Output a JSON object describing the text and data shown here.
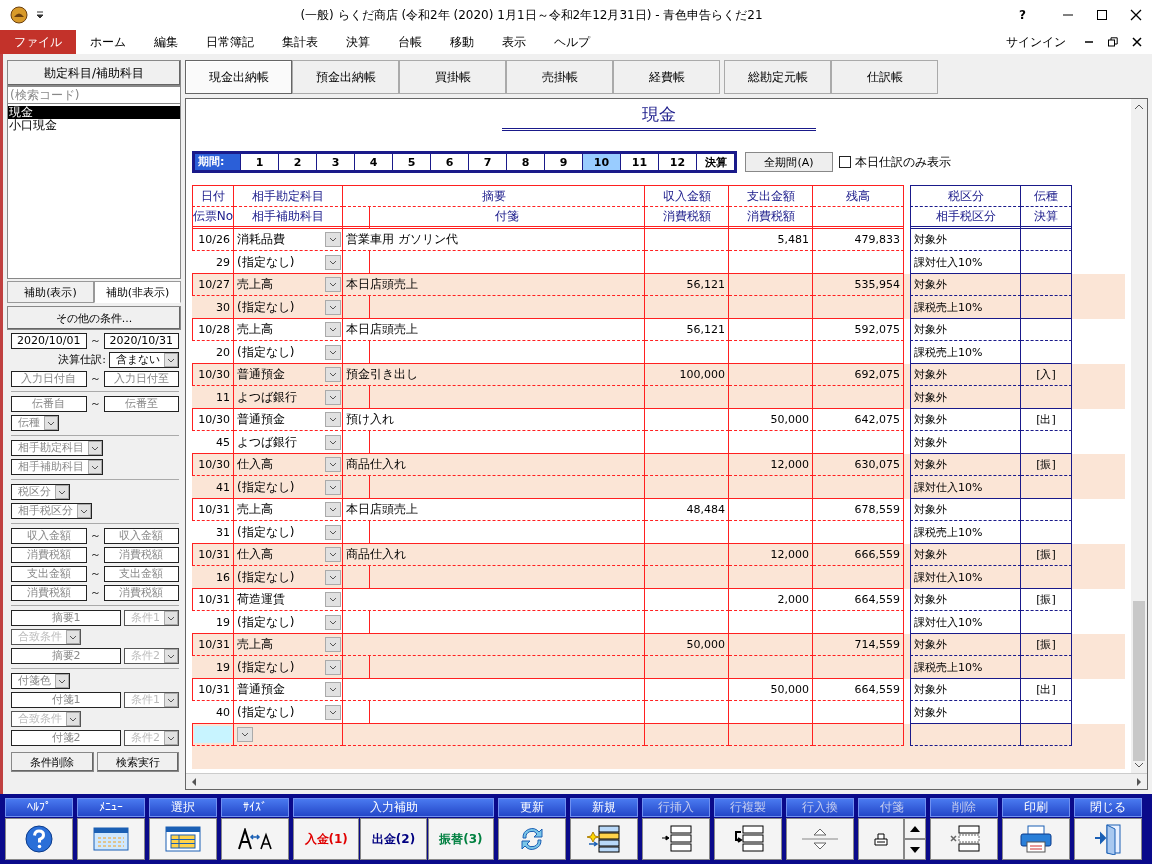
{
  "window": {
    "title": "(一般) らくだ商店 (令和2年 (2020) 1月1日～令和2年12月31日) - 青色申告らくだ21",
    "help": "?"
  },
  "menu": {
    "items": [
      {
        "label": "ファイル",
        "selected": true
      },
      {
        "label": "ホーム",
        "selected": false
      },
      {
        "label": "編集",
        "selected": false
      },
      {
        "label": "日常簿記",
        "selected": false
      },
      {
        "label": "集計表",
        "selected": false
      },
      {
        "label": "決算",
        "selected": false
      },
      {
        "label": "台帳",
        "selected": false
      },
      {
        "label": "移動",
        "selected": false
      },
      {
        "label": "表示",
        "selected": false
      },
      {
        "label": "ヘルプ",
        "selected": false
      }
    ],
    "sign_in": "サインイン"
  },
  "account_panel": {
    "title": "勘定科目/補助科目",
    "search": {
      "placeholder": "(検索コード)"
    },
    "accounts": [
      {
        "label": "現金",
        "selected": true
      },
      {
        "label": "小口現金",
        "selected": false
      }
    ],
    "sub_tabs": [
      {
        "label": "補助(表示)",
        "selected": false
      },
      {
        "label": "補助(非表示)",
        "selected": true
      }
    ],
    "more_button": "その他の条件..."
  },
  "filter_groups": [
    [
      [
        {
          "kind": "input",
          "value": "2020/10/01"
        },
        {
          "kind": "tilde",
          "text": "～"
        },
        {
          "kind": "input",
          "value": "2020/10/31"
        }
      ],
      [
        {
          "kind": "label",
          "text": "決算仕訳:"
        },
        {
          "kind": "select",
          "value": "含まない",
          "disabled": false
        }
      ],
      [
        {
          "kind": "input",
          "placeholder": "入力日付自"
        },
        {
          "kind": "tilde",
          "text": "～"
        },
        {
          "kind": "input",
          "placeholder": "入力日付至"
        }
      ]
    ],
    [
      [
        {
          "kind": "input",
          "placeholder": "伝番自"
        },
        {
          "kind": "tilde",
          "text": "～"
        },
        {
          "kind": "input",
          "placeholder": "伝番至"
        }
      ],
      [
        {
          "kind": "select",
          "placeholder": "伝種",
          "disabled": false
        }
      ]
    ],
    [
      [
        {
          "kind": "select",
          "placeholder": "相手勘定科目",
          "disabled": false
        }
      ],
      [
        {
          "kind": "select",
          "placeholder": "相手補助科目",
          "disabled": false
        }
      ]
    ],
    [
      [
        {
          "kind": "select",
          "placeholder": "税区分",
          "disabled": false
        }
      ],
      [
        {
          "kind": "select",
          "placeholder": "相手税区分",
          "disabled": false
        }
      ]
    ],
    [
      [
        {
          "kind": "input",
          "placeholder": "収入金額"
        },
        {
          "kind": "tilde",
          "text": "～"
        },
        {
          "kind": "input",
          "placeholder": "収入金額"
        }
      ],
      [
        {
          "kind": "input",
          "placeholder": "消費税額"
        },
        {
          "kind": "tilde",
          "text": "～"
        },
        {
          "kind": "input",
          "placeholder": "消費税額"
        }
      ],
      [
        {
          "kind": "input",
          "placeholder": "支出金額"
        },
        {
          "kind": "tilde",
          "text": "～"
        },
        {
          "kind": "input",
          "placeholder": "支出金額"
        }
      ],
      [
        {
          "kind": "input",
          "placeholder": "消費税額"
        },
        {
          "kind": "tilde",
          "text": "～"
        },
        {
          "kind": "input",
          "placeholder": "消費税額"
        }
      ]
    ],
    [
      [
        {
          "kind": "input",
          "placeholder": "摘要1"
        },
        {
          "kind": "select",
          "placeholder": "条件1",
          "disabled": true
        }
      ],
      [
        {
          "kind": "select",
          "placeholder": "合致条件",
          "disabled": true
        }
      ],
      [
        {
          "kind": "input",
          "placeholder": "摘要2"
        },
        {
          "kind": "select",
          "placeholder": "条件2",
          "disabled": true
        }
      ]
    ],
    [
      [
        {
          "kind": "select",
          "placeholder": "付箋色",
          "disabled": false
        }
      ],
      [
        {
          "kind": "input",
          "placeholder": "付箋1"
        },
        {
          "kind": "select",
          "placeholder": "条件1",
          "disabled": true
        }
      ],
      [
        {
          "kind": "select",
          "placeholder": "合致条件",
          "disabled": true
        }
      ],
      [
        {
          "kind": "input",
          "placeholder": "付箋2"
        },
        {
          "kind": "select",
          "placeholder": "条件2",
          "disabled": true
        }
      ]
    ]
  ],
  "filter_buttons": [
    "条件削除",
    "検索実行"
  ],
  "tab_groups": [
    [
      {
        "label": "現金出納帳",
        "selected": true
      },
      {
        "label": "預金出納帳",
        "selected": false
      },
      {
        "label": "買掛帳",
        "selected": false
      },
      {
        "label": "売掛帳",
        "selected": false
      },
      {
        "label": "経費帳",
        "selected": false
      }
    ],
    [
      {
        "label": "総勘定元帳",
        "selected": false
      },
      {
        "label": "仕訳帳",
        "selected": false
      }
    ]
  ],
  "ledger_title": "現金",
  "period": {
    "label": "期間:",
    "items": [
      {
        "label": "1",
        "selected": false
      },
      {
        "label": "2",
        "selected": false
      },
      {
        "label": "3",
        "selected": false
      },
      {
        "label": "4",
        "selected": false
      },
      {
        "label": "5",
        "selected": false
      },
      {
        "label": "6",
        "selected": false
      },
      {
        "label": "7",
        "selected": false
      },
      {
        "label": "8",
        "selected": false
      },
      {
        "label": "9",
        "selected": false
      },
      {
        "label": "10",
        "selected": true
      },
      {
        "label": "11",
        "selected": false
      },
      {
        "label": "12",
        "selected": false
      },
      {
        "label": "決算",
        "selected": false
      }
    ],
    "all_button": "全期間(A)",
    "today_only": {
      "label": "本日仕訳のみ表示",
      "checked": false
    }
  },
  "table": {
    "columns_top": [
      "日付",
      "相手勘定科目",
      "摘要",
      "収入金額",
      "支出金額",
      "残高",
      "税区分",
      "伝種"
    ],
    "columns_bottom": [
      "伝票No",
      "相手補助科目",
      "付箋",
      "消費税額",
      "消費税額",
      "相手税区分",
      "決算"
    ],
    "rows": [
      {
        "date": "10/26",
        "account": "消耗品費",
        "memo": "営業車用 ガソリン代",
        "expense": "5,481",
        "balance": "479,833",
        "tax_class": "対象外",
        "slip_no": "29",
        "sub_account": "(指定なし)",
        "partner_tax": "課対仕入10%"
      },
      {
        "date": "10/27",
        "account": "売上高",
        "memo": "本日店頭売上",
        "income": "56,121",
        "balance": "535,954",
        "tax_class": "対象外",
        "slip_no": "30",
        "sub_account": "(指定なし)",
        "partner_tax": "課税売上10%"
      },
      {
        "date": "10/28",
        "account": "売上高",
        "memo": "本日店頭売上",
        "income": "56,121",
        "balance": "592,075",
        "tax_class": "対象外",
        "slip_no": "20",
        "sub_account": "(指定なし)",
        "partner_tax": "課税売上10%"
      },
      {
        "date": "10/30",
        "account": "普通預金",
        "memo": "預金引き出し",
        "income": "100,000",
        "balance": "692,075",
        "tax_class": "対象外",
        "slip_type": "[入]",
        "slip_no": "11",
        "sub_account": "よつば銀行",
        "partner_tax": "対象外"
      },
      {
        "date": "10/30",
        "account": "普通預金",
        "memo": "預け入れ",
        "expense": "50,000",
        "balance": "642,075",
        "tax_class": "対象外",
        "slip_type": "[出]",
        "slip_no": "45",
        "sub_account": "よつば銀行",
        "partner_tax": "対象外"
      },
      {
        "date": "10/30",
        "account": "仕入高",
        "memo": "商品仕入れ",
        "expense": "12,000",
        "balance": "630,075",
        "tax_class": "対象外",
        "slip_type": "[振]",
        "slip_no": "41",
        "sub_account": "(指定なし)",
        "partner_tax": "課対仕入10%"
      },
      {
        "date": "10/31",
        "account": "売上高",
        "memo": "本日店頭売上",
        "income": "48,484",
        "balance": "678,559",
        "tax_class": "対象外",
        "slip_no": "31",
        "sub_account": "(指定なし)",
        "partner_tax": "課税売上10%"
      },
      {
        "date": "10/31",
        "account": "仕入高",
        "memo": "商品仕入れ",
        "expense": "12,000",
        "balance": "666,559",
        "tax_class": "対象外",
        "slip_type": "[振]",
        "slip_no": "16",
        "sub_account": "(指定なし)",
        "partner_tax": "課対仕入10%"
      },
      {
        "date": "10/31",
        "account": "荷造運賃",
        "expense": "2,000",
        "balance": "664,559",
        "tax_class": "対象外",
        "slip_type": "[振]",
        "slip_no": "19",
        "sub_account": "(指定なし)",
        "partner_tax": "課対仕入10%"
      },
      {
        "date": "10/31",
        "account": "売上高",
        "income": "50,000",
        "balance": "714,559",
        "tax_class": "対象外",
        "slip_type": "[振]",
        "slip_no": "19",
        "sub_account": "(指定なし)",
        "partner_tax": "課税売上10%"
      },
      {
        "date": "10/31",
        "account": "普通預金",
        "expense": "50,000",
        "balance": "664,559",
        "tax_class": "対象外",
        "slip_type": "[出]",
        "slip_no": "40",
        "sub_account": "(指定なし)",
        "partner_tax": "対象外"
      }
    ]
  },
  "toolbar": [
    {
      "kind": "help",
      "label": "ﾍﾙﾌﾟ",
      "disabled": false
    },
    {
      "kind": "menu",
      "label": "ﾒﾆｭｰ",
      "disabled": false
    },
    {
      "kind": "select",
      "label": "選択",
      "disabled": false
    },
    {
      "kind": "size",
      "label": "ｻｲｽﾞ",
      "disabled": false
    },
    {
      "kind": "assist",
      "label": "入力補助",
      "disabled": false,
      "buttons": [
        {
          "label": "入金(1)",
          "color": "#e00000"
        },
        {
          "label": "出金(2)",
          "color": "#000080"
        },
        {
          "label": "振替(3)",
          "color": "#008040"
        }
      ]
    },
    {
      "kind": "refresh",
      "label": "更新",
      "disabled": false
    },
    {
      "kind": "new",
      "label": "新規",
      "disabled": false
    },
    {
      "kind": "insert",
      "label": "行挿入",
      "disabled": true
    },
    {
      "kind": "copy",
      "label": "行複製",
      "disabled": true
    },
    {
      "kind": "swap",
      "label": "行入換",
      "disabled": true
    },
    {
      "kind": "note",
      "label": "付箋",
      "disabled": true
    },
    {
      "kind": "delete",
      "label": "削除",
      "disabled": true
    },
    {
      "kind": "print",
      "label": "印刷",
      "disabled": false
    },
    {
      "kind": "close",
      "label": "閉じる",
      "disabled": false
    }
  ]
}
